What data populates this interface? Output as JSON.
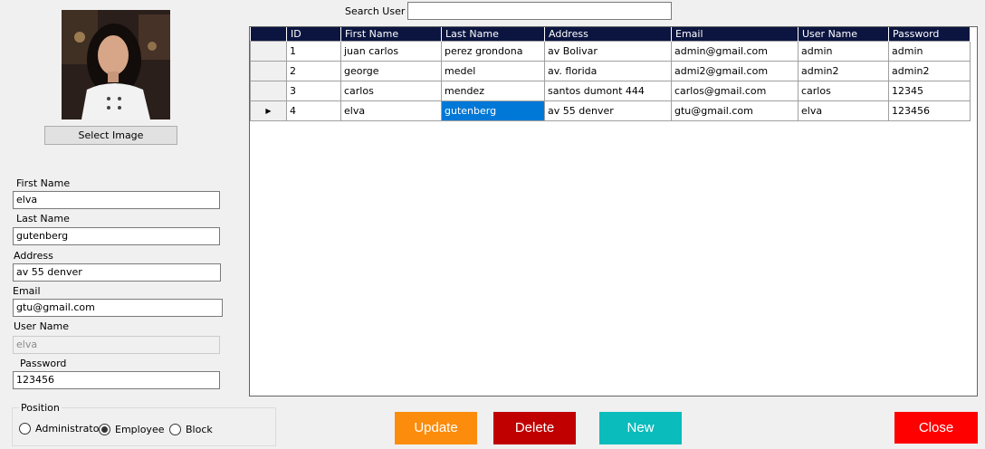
{
  "profile": {
    "select_image_label": "Select Image"
  },
  "form": {
    "first_name_label": "First Name",
    "first_name_value": "elva",
    "last_name_label": "Last Name",
    "last_name_value": "gutenberg",
    "address_label": "Address",
    "address_value": "av 55 denver",
    "email_label": "Email",
    "email_value": "gtu@gmail.com",
    "user_name_label": "User Name",
    "user_name_value": "elva",
    "password_label": "Password",
    "password_value": "123456"
  },
  "position": {
    "title": "Position",
    "options": [
      "Administrator",
      "Employee",
      "Block"
    ],
    "selected": "Employee"
  },
  "search": {
    "label": "Search User",
    "value": ""
  },
  "grid": {
    "columns": [
      "ID",
      "First Name",
      "Last Name",
      "Address",
      "Email",
      "User Name",
      "Password"
    ],
    "rows": [
      [
        "1",
        "juan carlos",
        "perez grondona",
        "av Bolivar",
        "admin@gmail.com",
        "admin",
        "admin"
      ],
      [
        "2",
        "george",
        "medel",
        "av. florida",
        "admi2@gmail.com",
        "admin2",
        "admin2"
      ],
      [
        "3",
        "carlos",
        "mendez",
        "santos dumont 444",
        "carlos@gmail.com",
        "carlos",
        "12345"
      ],
      [
        "4",
        "elva",
        "gutenberg",
        "av 55 denver",
        "gtu@gmail.com",
        "elva",
        "123456"
      ]
    ],
    "current_row_indicator": "▶",
    "selected_row": 3,
    "selected_col": 2,
    "header_color": "#0b1540",
    "selection_color": "#0078d7"
  },
  "actions": {
    "update_label": "Update",
    "delete_label": "Delete",
    "new_label": "New",
    "close_label": "Close",
    "update_color": "#fc8c0c",
    "delete_color": "#c00000",
    "new_color": "#0bbcbc",
    "close_color": "#ff0000"
  }
}
